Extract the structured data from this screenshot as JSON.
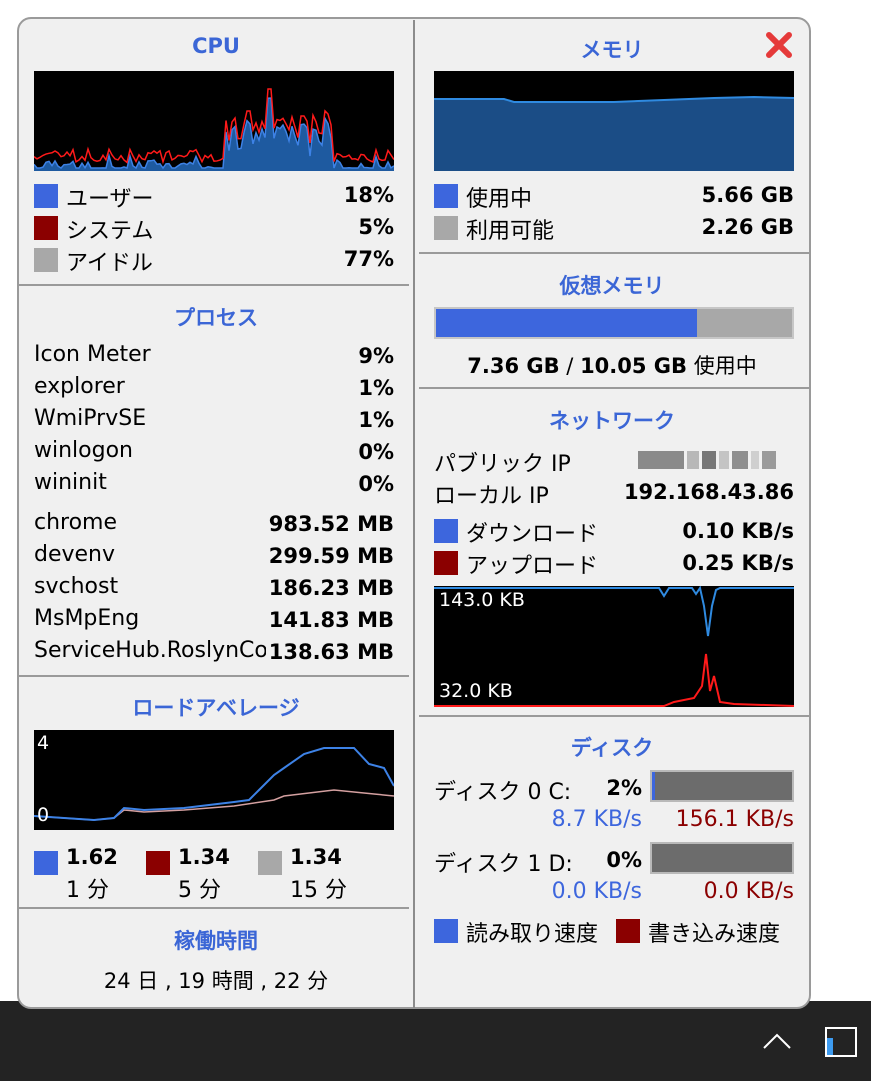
{
  "cpu": {
    "title": "CPU",
    "legend": [
      {
        "label": "ユーザー",
        "value": "18%",
        "color": "#3d66dd"
      },
      {
        "label": "システム",
        "value": "5%",
        "color": "#8b0000"
      },
      {
        "label": "アイドル",
        "value": "77%",
        "color": "#a8a8a8"
      }
    ]
  },
  "processes": {
    "title": "プロセス",
    "cpu_items": [
      {
        "name": "Icon Meter",
        "value": "9%"
      },
      {
        "name": "explorer",
        "value": "1%"
      },
      {
        "name": "WmiPrvSE",
        "value": "1%"
      },
      {
        "name": "winlogon",
        "value": "0%"
      },
      {
        "name": "wininit",
        "value": "0%"
      }
    ],
    "mem_items": [
      {
        "name": "chrome",
        "value": "983.52 MB"
      },
      {
        "name": "devenv",
        "value": "299.59 MB"
      },
      {
        "name": "svchost",
        "value": "186.23 MB"
      },
      {
        "name": "MsMpEng",
        "value": "141.83 MB"
      },
      {
        "name": "ServiceHub.RoslynCoc",
        "value": "138.63 MB"
      }
    ]
  },
  "load_average": {
    "title": "ロードアベレージ",
    "y_max_label": "4",
    "y_min_label": "0",
    "items": [
      {
        "value": "1.62",
        "period": "1 分",
        "color": "#3d66dd"
      },
      {
        "value": "1.34",
        "period": "5 分",
        "color": "#8b0000"
      },
      {
        "value": "1.34",
        "period": "15 分",
        "color": "#a8a8a8"
      }
    ]
  },
  "uptime": {
    "title": "稼働時間",
    "text": "24 日 , 19 時間 , 22 分"
  },
  "memory": {
    "title": "メモリ",
    "legend": [
      {
        "label": "使用中",
        "value": "5.66 GB",
        "color": "#3d66dd"
      },
      {
        "label": "利用可能",
        "value": "2.26 GB",
        "color": "#a8a8a8"
      }
    ]
  },
  "virtual_memory": {
    "title": "仮想メモリ",
    "used": "7.36 GB",
    "separator": " / ",
    "total": "10.05 GB",
    "suffix": " 使用中",
    "fill_fraction": 0.7323
  },
  "network": {
    "title": "ネットワーク",
    "public_ip_label": "パブリック IP",
    "local_ip_label": "ローカル IP",
    "local_ip": "192.168.43.86",
    "download_label": "ダウンロード",
    "download_value": "0.10 KB/s",
    "upload_label": "アップロード",
    "upload_value": "0.25 KB/s",
    "graph_top_label": "143.0 KB",
    "graph_bottom_label": "32.0 KB"
  },
  "disk": {
    "title": "ディスク",
    "disks": [
      {
        "label": "ディスク 0 C:",
        "percent": "2%",
        "fill": 0.02,
        "read": "8.7 KB/s",
        "write": "156.1 KB/s"
      },
      {
        "label": "ディスク 1 D:",
        "percent": "0%",
        "fill": 0.0,
        "read": "0.0 KB/s",
        "write": "0.0 KB/s"
      }
    ],
    "legend_read": "読み取り速度",
    "legend_write": "書き込み速度"
  }
}
